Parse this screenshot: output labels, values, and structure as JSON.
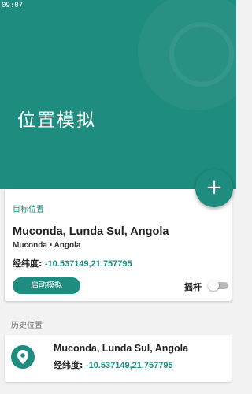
{
  "status_bar": {
    "time": "09:07"
  },
  "header": {
    "title": "位置模拟"
  },
  "fab": {
    "icon": "plus-icon",
    "label": "+"
  },
  "target_card": {
    "section_label": "目标位置",
    "place_name": "Muconda, Lunda Sul, Angola",
    "place_sub": "Muconda • Angola",
    "coord_label": "经纬度:",
    "coord_value": "-10.537149,21.757795",
    "start_button": "启动模拟",
    "joystick_label": "摇杆",
    "joystick_on": false
  },
  "history": {
    "section_label": "历史位置",
    "items": [
      {
        "icon": "location-pin-icon",
        "place_name": "Muconda, Lunda Sul, Angola",
        "coord_label": "经纬度:",
        "coord_value": "-10.537149,21.757795"
      }
    ]
  },
  "colors": {
    "accent": "#1e8c7e",
    "background": "#f2f2f2"
  }
}
